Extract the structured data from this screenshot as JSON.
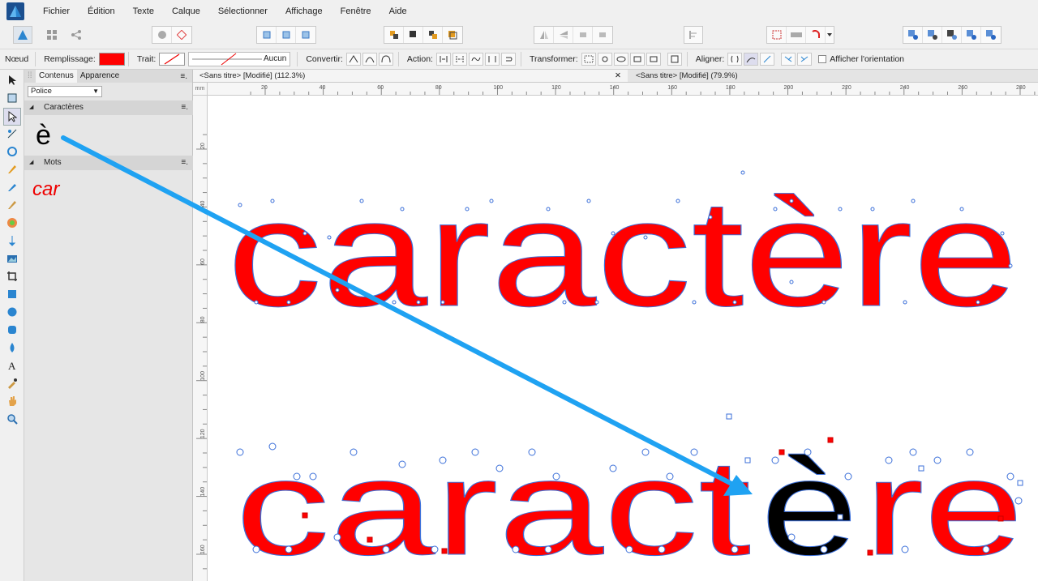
{
  "menu": {
    "items": [
      "Fichier",
      "Édition",
      "Texte",
      "Calque",
      "Sélectionner",
      "Affichage",
      "Fenêtre",
      "Aide"
    ]
  },
  "contextbar": {
    "noeud": "Nœud",
    "remplissage": "Remplissage:",
    "fill_color": "#ff0000",
    "trait": "Trait:",
    "stroke_none": "Aucun",
    "convertir": "Convertir:",
    "action": "Action:",
    "transformer": "Transformer:",
    "aligner": "Aligner:",
    "afficher": "Afficher l'orientation"
  },
  "panel": {
    "tab_contenus": "Contenus",
    "tab_apparence": "Apparence",
    "police": "Police",
    "section_caracteres": "Caractères",
    "char_preview": "è",
    "section_mots": "Mots",
    "word_preview": "car"
  },
  "doctabs": {
    "tab1": "<Sans titre> [Modifié] (112.3%)",
    "tab2": "<Sans titre> [Modifié] (79.9%)"
  },
  "rulers": {
    "unit": "mm",
    "h_labels": [
      "20",
      "40",
      "60",
      "80",
      "100",
      "120",
      "140",
      "160",
      "180",
      "200",
      "220",
      "240",
      "260",
      "280"
    ],
    "v_labels": [
      "20",
      "40",
      "60",
      "80",
      "100",
      "120",
      "140",
      "160"
    ]
  },
  "canvas": {
    "word_top": "caractère",
    "word_bottom_prefix": "caract",
    "word_bottom_char": "è",
    "word_bottom_suffix": "re"
  },
  "colors": {
    "accent_blue": "#1fa2f2",
    "glyph_red": "#ff0000",
    "node_blue": "#3b6fd9"
  }
}
